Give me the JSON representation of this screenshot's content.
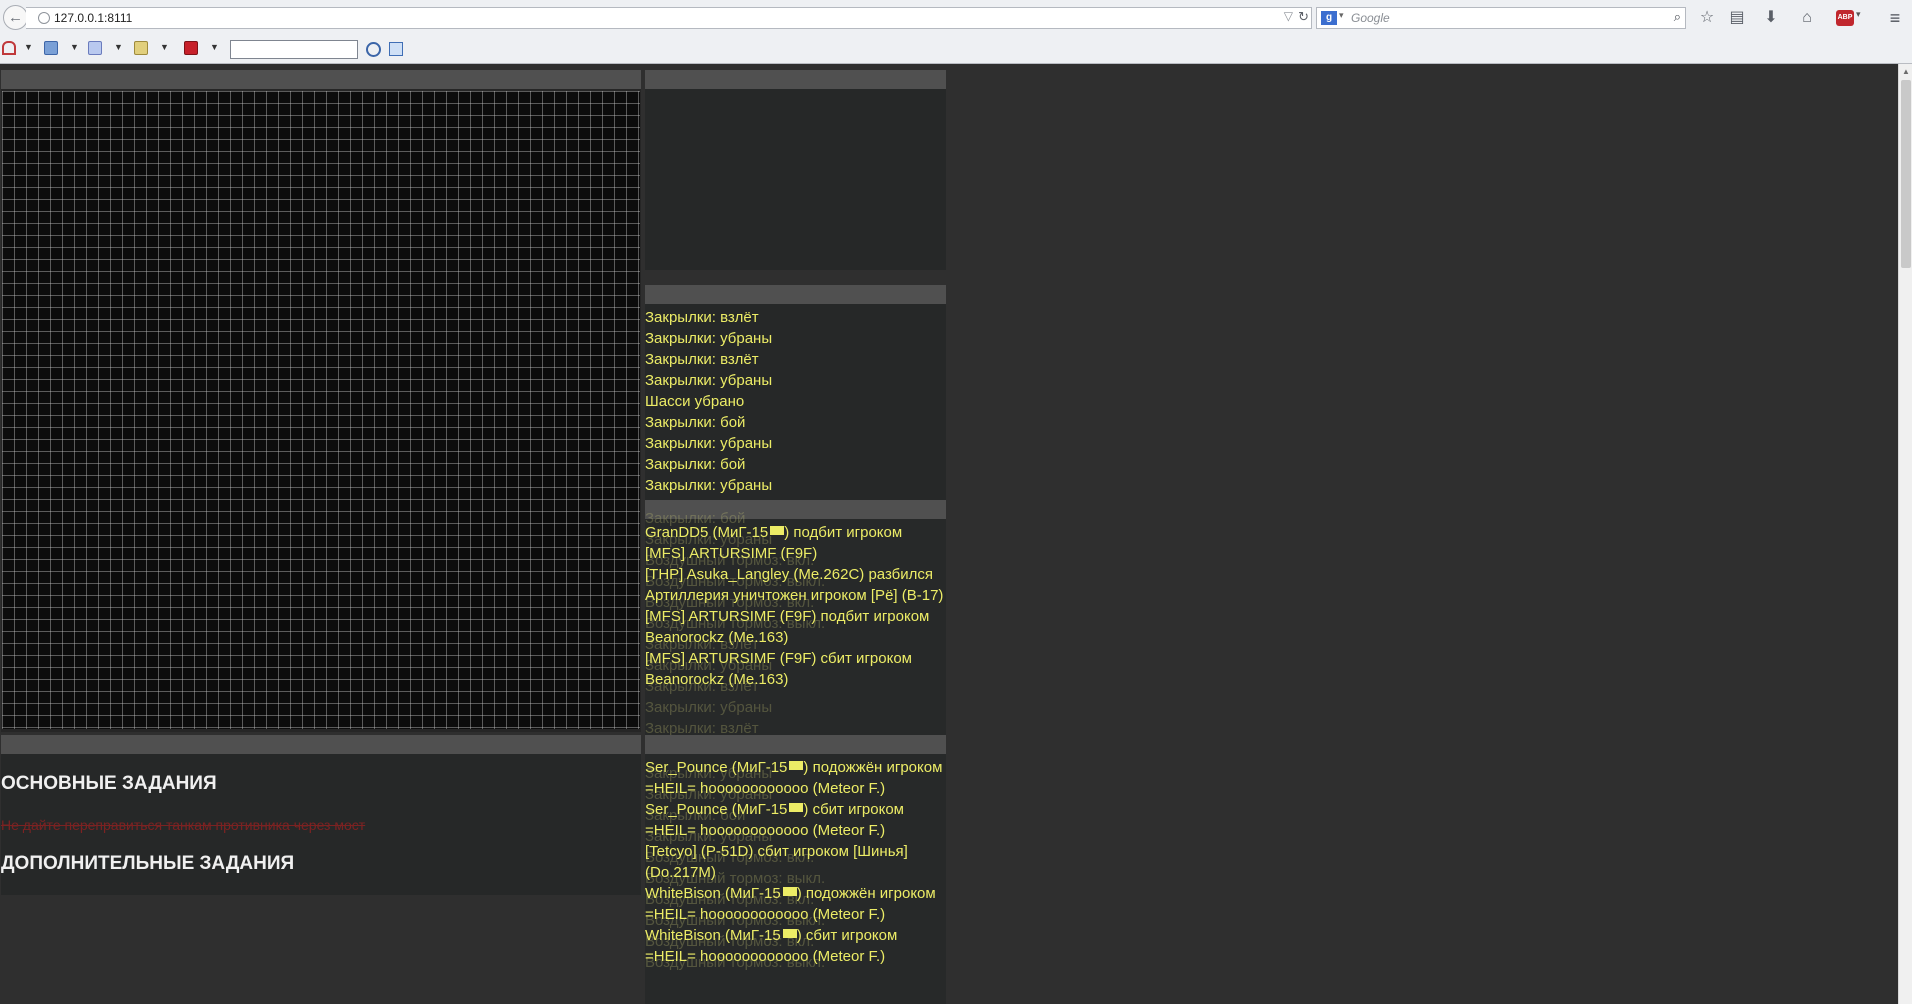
{
  "browser": {
    "url": "127.0.0.1:8111",
    "search_placeholder": "Google",
    "search_engine_letter": "g"
  },
  "tools": {
    "icons": [
      "home-icon",
      "page-icon",
      "document-icon",
      "clipboard-icon",
      "book-icon"
    ],
    "search_value": ""
  },
  "flaps_log": [
    "Закрылки: взлёт",
    "Закрылки: убраны",
    "Закрылки: взлёт",
    "Закрылки: убраны",
    "Шасси убрано",
    "Закрылки: бой",
    "Закрылки: убраны",
    "Закрылки: бой",
    "Закрылки: убраны"
  ],
  "flaps_log_ghost": [
    "Закрылки: бой",
    "Закрылки: убраны",
    "Воздушный тормоз: вкл.",
    "Воздушный тормоз: выкл.",
    "Воздушный тормоз: вкл.",
    "Воздушный тормоз: выкл.",
    "Закрылки: взлёт",
    "Закрылки: убраны",
    "Закрылки: взлёт",
    "Закрылки: убраны",
    "Закрылки: взлёт",
    "Закрылки: убраны"
  ],
  "kills_a": [
    {
      "text": "GranDD5 (МиГ-15",
      "flag": true,
      "rest": ") подбит игроком [MFS] ARTURSIMF (F9F)"
    },
    {
      "text": "[THP] Asuka_Langley (Me.262C) разбился",
      "flag": false,
      "rest": ""
    },
    {
      "text": "Артиллерия уничтожен игроком [Рё] (B-17)",
      "flag": false,
      "rest": ""
    },
    {
      "text": "[MFS] ARTURSIMF (F9F) подбит игроком Beanorockz (Me.163)",
      "flag": false,
      "rest": ""
    },
    {
      "text": "[MFS] ARTURSIMF (F9F) сбит игроком Beanorockz (Me.163)",
      "flag": false,
      "rest": ""
    }
  ],
  "kills_b": [
    {
      "text": "Ser_Pounce (МиГ-15",
      "flag": true,
      "rest": ") подожжён игроком =HEIL= hoooooooooooo (Meteor F.)"
    },
    {
      "text": "Ser_Pounce (МиГ-15",
      "flag": true,
      "rest": ") сбит игроком =HEIL= hoooooooooooo (Meteor F.)"
    },
    {
      "text": "[Tetcyo] (P-51D) сбит игроком [Шинья] (Do.217M)",
      "flag": false,
      "rest": ""
    },
    {
      "text": "WhiteBison (МиГ-15",
      "flag": true,
      "rest": ") подожжён игроком =HEIL= hoooooooooooo (Meteor F.)"
    },
    {
      "text": "WhiteBison (МиГ-15",
      "flag": true,
      "rest": ") сбит игроком =HEIL= hoooooooooooo (Meteor F.)"
    }
  ],
  "kills_b_ghost": [
    "Закрылки: убраны",
    "Закрылки: убраны",
    "Закрылки: бой",
    "Закрылки: убраны",
    "Воздушный тормоз: вкл.",
    "Воздушный тормоз: выкл.",
    "Воздушный тормоз: вкл.",
    "Воздушный тормоз: выкл.",
    "Воздушный тормоз: вкл.",
    "Воздушный тормоз: выкл."
  ],
  "tasks": {
    "main_title": "ОСНОВНЫЕ ЗАДАНИЯ",
    "item": "Не дайте переправиться танкам противника через мост",
    "extra_title": "ДОПОЛНИТЕЛЬНЫЕ ЗАДАНИЯ"
  },
  "colors": {
    "background": "#2f2f2f",
    "panel": "#262828",
    "panel_header": "#505050",
    "log_text": "#ecec66",
    "task_failed": "#7c2222"
  }
}
